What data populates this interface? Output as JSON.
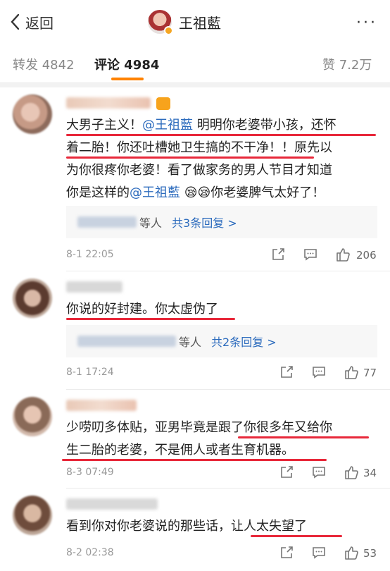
{
  "nav": {
    "back_label": "返回",
    "title": "王祖藍",
    "more": "···"
  },
  "tabs": {
    "repost": "转发 4842",
    "comment": "评论 4984",
    "like": "赞 7.2万"
  },
  "comments": [
    {
      "lines": [
        [
          "大男子主义！",
          {
            "at": "@王祖藍"
          },
          " 明明你老婆带小孩，还怀"
        ],
        [
          "着二胎！你还吐槽她卫生搞的不干净！！原先以"
        ],
        [
          "为你很疼你老婆！看了做家务的男人节目才知道"
        ],
        [
          "你是这样的",
          {
            "at": "@王祖藍"
          },
          " 😪😪你老婆脾气太好了！"
        ]
      ],
      "reply_suffix": "等人",
      "reply_more": "共3条回复 >",
      "time": "8-1 22:05",
      "likes": "206"
    },
    {
      "lines": [
        [
          "你说的好封建。你太虚伪了"
        ]
      ],
      "reply_suffix": "等人",
      "reply_more": "共2条回复 >",
      "time": "8-1 17:24",
      "likes": "77"
    },
    {
      "lines": [
        [
          "少唠叨多体贴，亚男毕竟是跟了你很多年又给你"
        ],
        [
          "生二胎的老婆，不是佣人或者生育机器。"
        ]
      ],
      "time": "8-3 07:49",
      "likes": "34"
    },
    {
      "lines": [
        [
          "看到你对你老婆说的那些话，让人太失望了"
        ]
      ],
      "time": "8-2 02:38",
      "likes": "53"
    }
  ],
  "colors": {
    "accent": "#ff8200",
    "mention": "#2c6bbd",
    "underline": "#e8283a"
  }
}
